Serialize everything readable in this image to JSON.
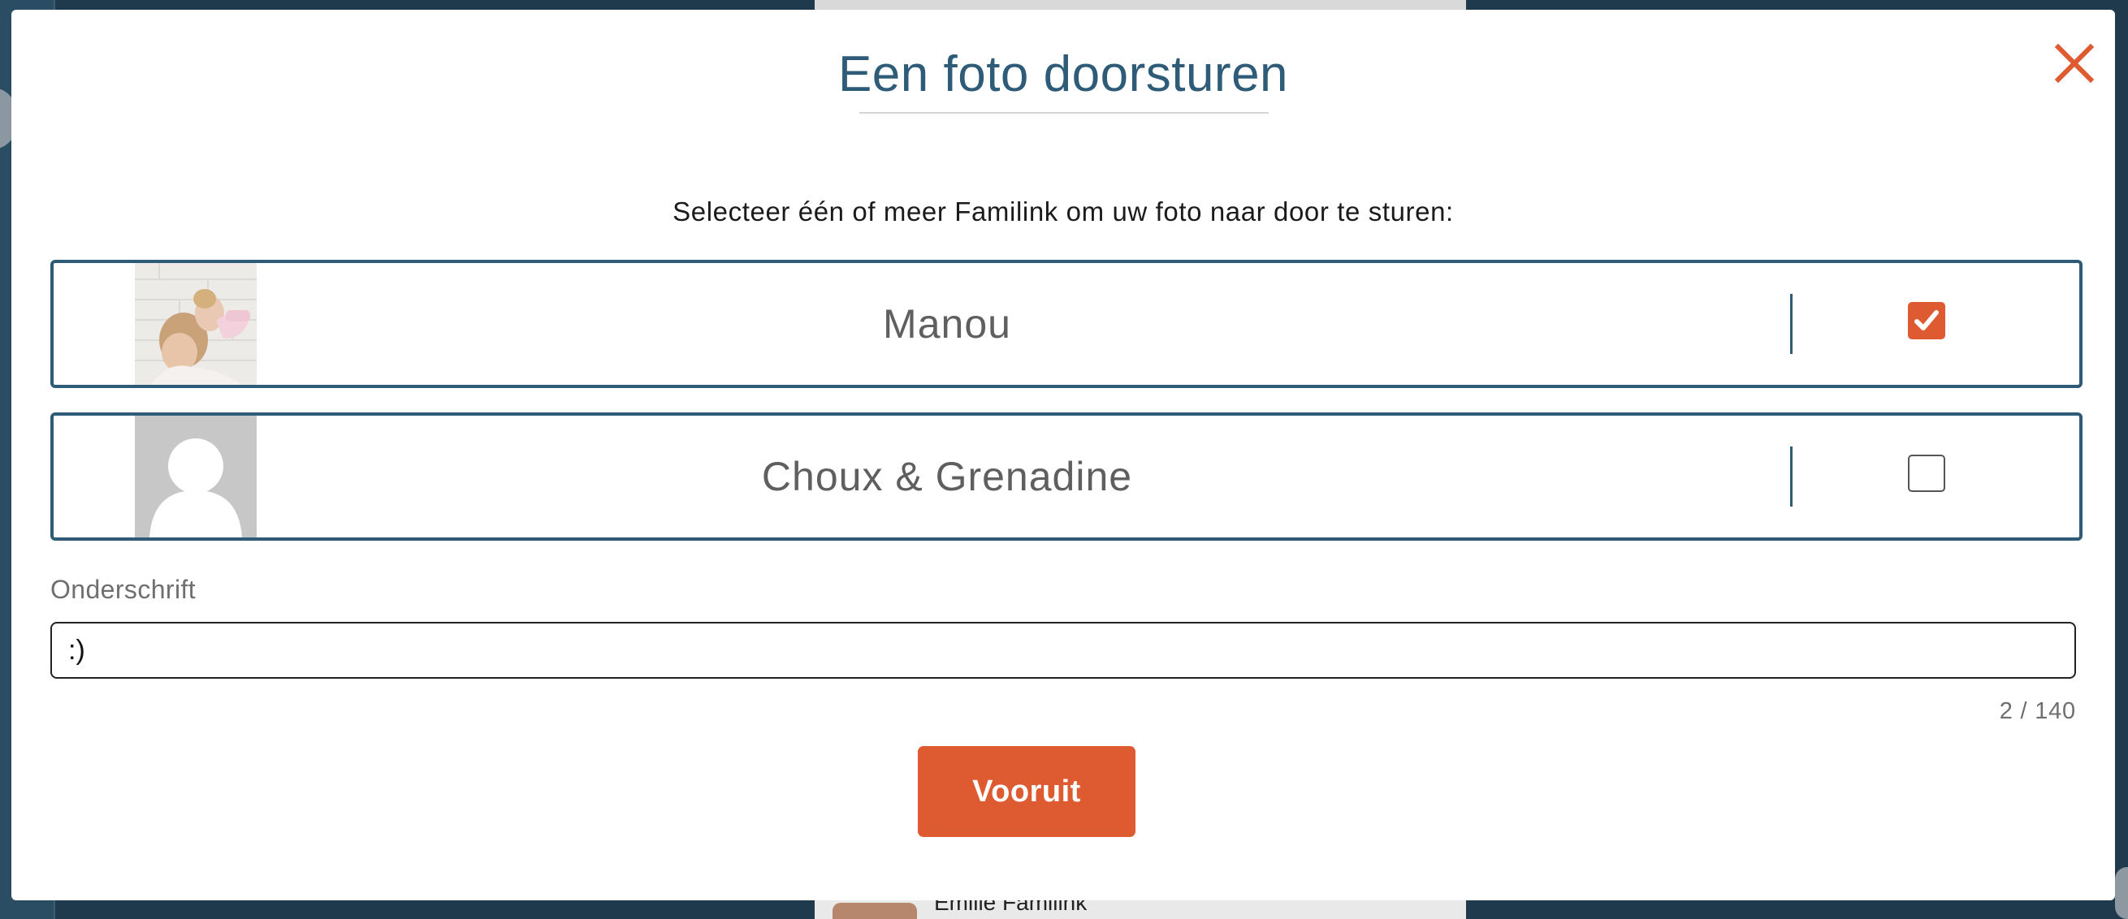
{
  "background": {
    "contact_name": "Emilie Familink"
  },
  "modal": {
    "title": "Een foto doorsturen",
    "close_icon": "close-icon",
    "instruction": "Selecteer één of meer Familink om uw foto naar door te sturen:",
    "recipients": [
      {
        "name": "Manou",
        "checked": true,
        "photo": "family-photo"
      },
      {
        "name": "Choux & Grenadine",
        "checked": false,
        "photo": "default-avatar"
      }
    ],
    "caption": {
      "label": "Onderschrift",
      "value": ":)",
      "count": "2 / 140"
    },
    "next_label": "Vooruit"
  },
  "colors": {
    "accent": "#de5a31",
    "primary": "#2e5c78",
    "overlay": "#1f3a4d"
  }
}
